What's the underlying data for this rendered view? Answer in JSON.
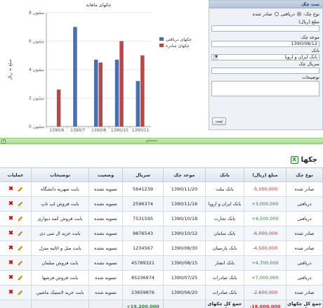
{
  "form": {
    "title": "ثبت چک",
    "type_label": "نوع چک:",
    "type_received": "دریافتی",
    "type_issued": "صادر شده",
    "amount_label": "مبلغ (ریال)",
    "amount_value": "",
    "date_label": "موعد چک",
    "date_value": "1390/08/12",
    "bank_label": "بانک",
    "bank_value": "بانک ایران و اروپا",
    "serial_label": "سریال چک",
    "serial_value": "",
    "desc_label": "توضیحات",
    "submit_label": "ثبت"
  },
  "chart_data": {
    "type": "bar",
    "title": "چکهای ماهانه",
    "ylabel": "مبلغ به ریال",
    "categories": [
      "1390/6",
      "1390/7",
      "1390/8",
      "1390/10",
      "1390/11"
    ],
    "series": [
      {
        "name": "چکهای دریافتی",
        "values": [
          0,
          7,
          4.7,
          4.7,
          3.2
        ]
      },
      {
        "name": "چکهای صادره",
        "values": [
          2.6,
          0,
          4.5,
          6,
          5
        ]
      }
    ],
    "ylim": [
      0,
      8
    ],
    "yticks": [
      "0 میلیون",
      "2 میلیون",
      "4 میلیون",
      "6 میلیون",
      "8 میلیون"
    ],
    "colors": {
      "received": "#4a6fae",
      "issued": "#b44a4a"
    },
    "grid": true,
    "legend": "right"
  },
  "separator": {
    "label": "جستجو",
    "toggle": "+"
  },
  "checks": {
    "title": "چکها",
    "export_icon": "excel-icon",
    "columns": [
      "نوع چک",
      "مبلغ (ریال)",
      "بانک",
      "موعد چک",
      "سریال",
      "وضعیت",
      "توضیحات",
      "عملیات"
    ],
    "rows": [
      {
        "type": "صادر شده",
        "amount": "-5,000,000",
        "bank": "بانک ملت",
        "date": "1390/11/20",
        "serial": "5641239",
        "status": "تسویه نشده",
        "desc": "بابت شهریه دانشگاه"
      },
      {
        "type": "دریافتی",
        "amount": "+3,000,000",
        "bank": "بانک ایران و اروپا",
        "date": "1390/11/16",
        "serial": "2596374",
        "status": "تسویه نشده",
        "desc": "بابت فروش لپ تاپ"
      },
      {
        "type": "دریافتی",
        "amount": "+4,500,000",
        "bank": "بانک تجارت",
        "date": "1390/10/18",
        "serial": "7531595",
        "status": "تسویه نشده",
        "desc": "بابت فروش کمد دیواری"
      },
      {
        "type": "صادر شده",
        "amount": "-6,000,000",
        "bank": "بانک سامان",
        "date": "1390/10/12",
        "serial": "9876543",
        "status": "تسویه نشده",
        "desc": "بابت خرید ال سی دی"
      },
      {
        "type": "صادر شده",
        "amount": "-4,500,000",
        "bank": "بانک پارسیان",
        "date": "1390/08/30",
        "serial": "1234567",
        "status": "تسویه نشده",
        "desc": "بابت مبل و اثاثیه منزل"
      },
      {
        "type": "دریافتی",
        "amount": "+4,700,000",
        "bank": "بانک انصار",
        "date": "1390/08/15",
        "serial": "45789321",
        "status": "تسویه نشده",
        "desc": "بابت فروش مبلمان"
      },
      {
        "type": "دریافتی",
        "amount": "+7,000,000",
        "bank": "بانک صادرات",
        "date": "1390/07/25",
        "serial": "85236974",
        "status": "تسویه شده",
        "desc": "بابت فروش فرشها"
      },
      {
        "type": "صادر شده",
        "amount": "-2,600,000",
        "bank": "بانک صادرات",
        "date": "1390/06/20",
        "serial": "23659876",
        "status": "تسویه شده",
        "desc": "بابت خرید لاستیک ماشین"
      }
    ],
    "footer": {
      "issued_label": "جمع کل چکهای صادره",
      "issued_total": "-18,000,000",
      "received_label": "جمع کل چکهای دریافتی",
      "received_total": "+19,200,000"
    }
  }
}
